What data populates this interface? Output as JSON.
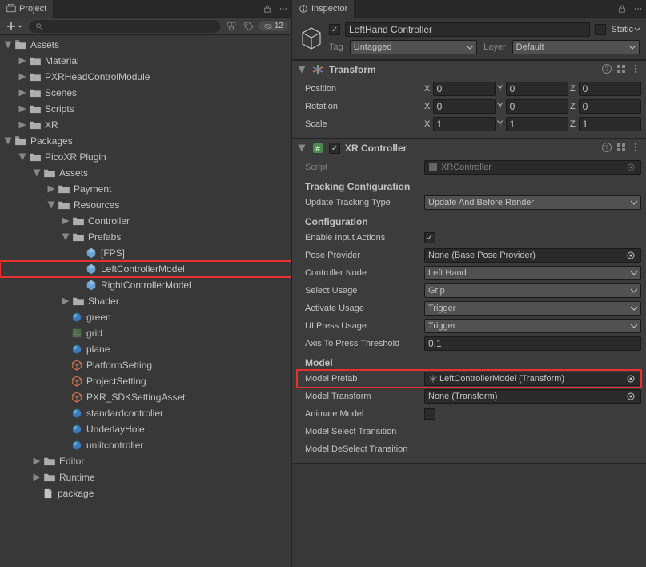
{
  "project": {
    "tab_label": "Project",
    "search_placeholder": "",
    "hidden_count": "12",
    "tree": {
      "assets": {
        "label": "Assets",
        "children": {
          "material": "Material",
          "pxr": "PXRHeadControlModule",
          "scenes": "Scenes",
          "scripts": "Scripts",
          "xr": "XR"
        }
      },
      "packages": {
        "label": "Packages",
        "picoxr": {
          "label": "PicoXR Plugin",
          "assets": {
            "label": "Assets",
            "payment": "Payment",
            "resources": {
              "label": "Resources",
              "controller": "Controller",
              "prefabs": {
                "label": "Prefabs",
                "fps": "[FPS]",
                "left": "LeftControllerModel",
                "right": "RightControllerModel"
              },
              "shader": "Shader",
              "green": "green",
              "grid": "grid",
              "plane": "plane",
              "platform": "PlatformSetting",
              "project": "ProjectSetting",
              "sdk": "PXR_SDKSettingAsset",
              "std": "standardcontroller",
              "underlay": "UnderlayHole",
              "unlit": "unlitcontroller"
            }
          },
          "editor": "Editor",
          "runtime": "Runtime",
          "package": "package"
        }
      }
    }
  },
  "inspector": {
    "tab_label": "Inspector",
    "go_name": "LeftHand Controller",
    "static_label": "Static",
    "tag_label": "Tag",
    "tag_value": "Untagged",
    "layer_label": "Layer",
    "layer_value": "Default",
    "transform": {
      "title": "Transform",
      "position": {
        "label": "Position",
        "x": "0",
        "y": "0",
        "z": "0"
      },
      "rotation": {
        "label": "Rotation",
        "x": "0",
        "y": "0",
        "z": "0"
      },
      "scale": {
        "label": "Scale",
        "x": "1",
        "y": "1",
        "z": "1"
      }
    },
    "xr": {
      "title": "XR Controller",
      "script_label": "Script",
      "script_value": "XRController",
      "tracking_header": "Tracking Configuration",
      "update_label": "Update Tracking Type",
      "update_value": "Update And Before Render",
      "config_header": "Configuration",
      "enable_label": "Enable Input Actions",
      "pose_label": "Pose Provider",
      "pose_value": "None (Base Pose Provider)",
      "node_label": "Controller Node",
      "node_value": "Left Hand",
      "select_label": "Select Usage",
      "select_value": "Grip",
      "activate_label": "Activate Usage",
      "activate_value": "Trigger",
      "ui_label": "UI Press Usage",
      "ui_value": "Trigger",
      "axis_label": "Axis To Press Threshold",
      "axis_value": "0.1",
      "model_header": "Model",
      "prefab_label": "Model Prefab",
      "prefab_value": "LeftControllerModel (Transform)",
      "mtrans_label": "Model Transform",
      "mtrans_value": "None (Transform)",
      "animate_label": "Animate Model",
      "msel_label": "Model Select Transition",
      "mdesel_label": "Model DeSelect Transition"
    }
  }
}
